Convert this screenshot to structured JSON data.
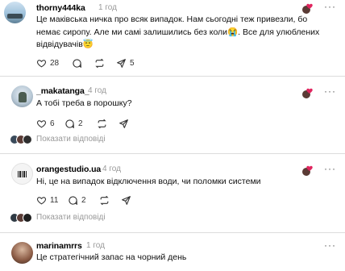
{
  "comments": [
    {
      "username": "thorny444ka",
      "time": "1 год",
      "text": "Це маківська ничка про всяк випадок. Нам сьогодні теж привезли, бо немає сиропу. Але ми самі залишились без коли😭. Все для улюблених відвідувачів😇",
      "likes": "28",
      "replies_count": "",
      "shares": "5",
      "show_replies": ""
    },
    {
      "username": "_makatanga_",
      "time": "4 год",
      "text": "А тобі треба в порошку?",
      "likes": "6",
      "replies_count": "2",
      "shares": "",
      "show_replies": "Показати відповіді"
    },
    {
      "username": "orangestudio.ua",
      "time": "4 год",
      "text": "Ні, це на випадок відключення води, чи поломки системи",
      "likes": "11",
      "replies_count": "2",
      "shares": "",
      "show_replies": "Показати відповіді"
    },
    {
      "username": "marinamrrs",
      "time": "1 год",
      "text": "Це стратегічний запас на чорний день",
      "likes": "",
      "replies_count": "",
      "shares": "",
      "show_replies": ""
    }
  ],
  "more_glyph": "···",
  "colors": {
    "heart": "#e0245e",
    "muted": "#999999",
    "text": "#101010"
  },
  "icons": [
    "heart-icon",
    "comment-icon",
    "repost-icon",
    "share-icon",
    "more-icon"
  ]
}
